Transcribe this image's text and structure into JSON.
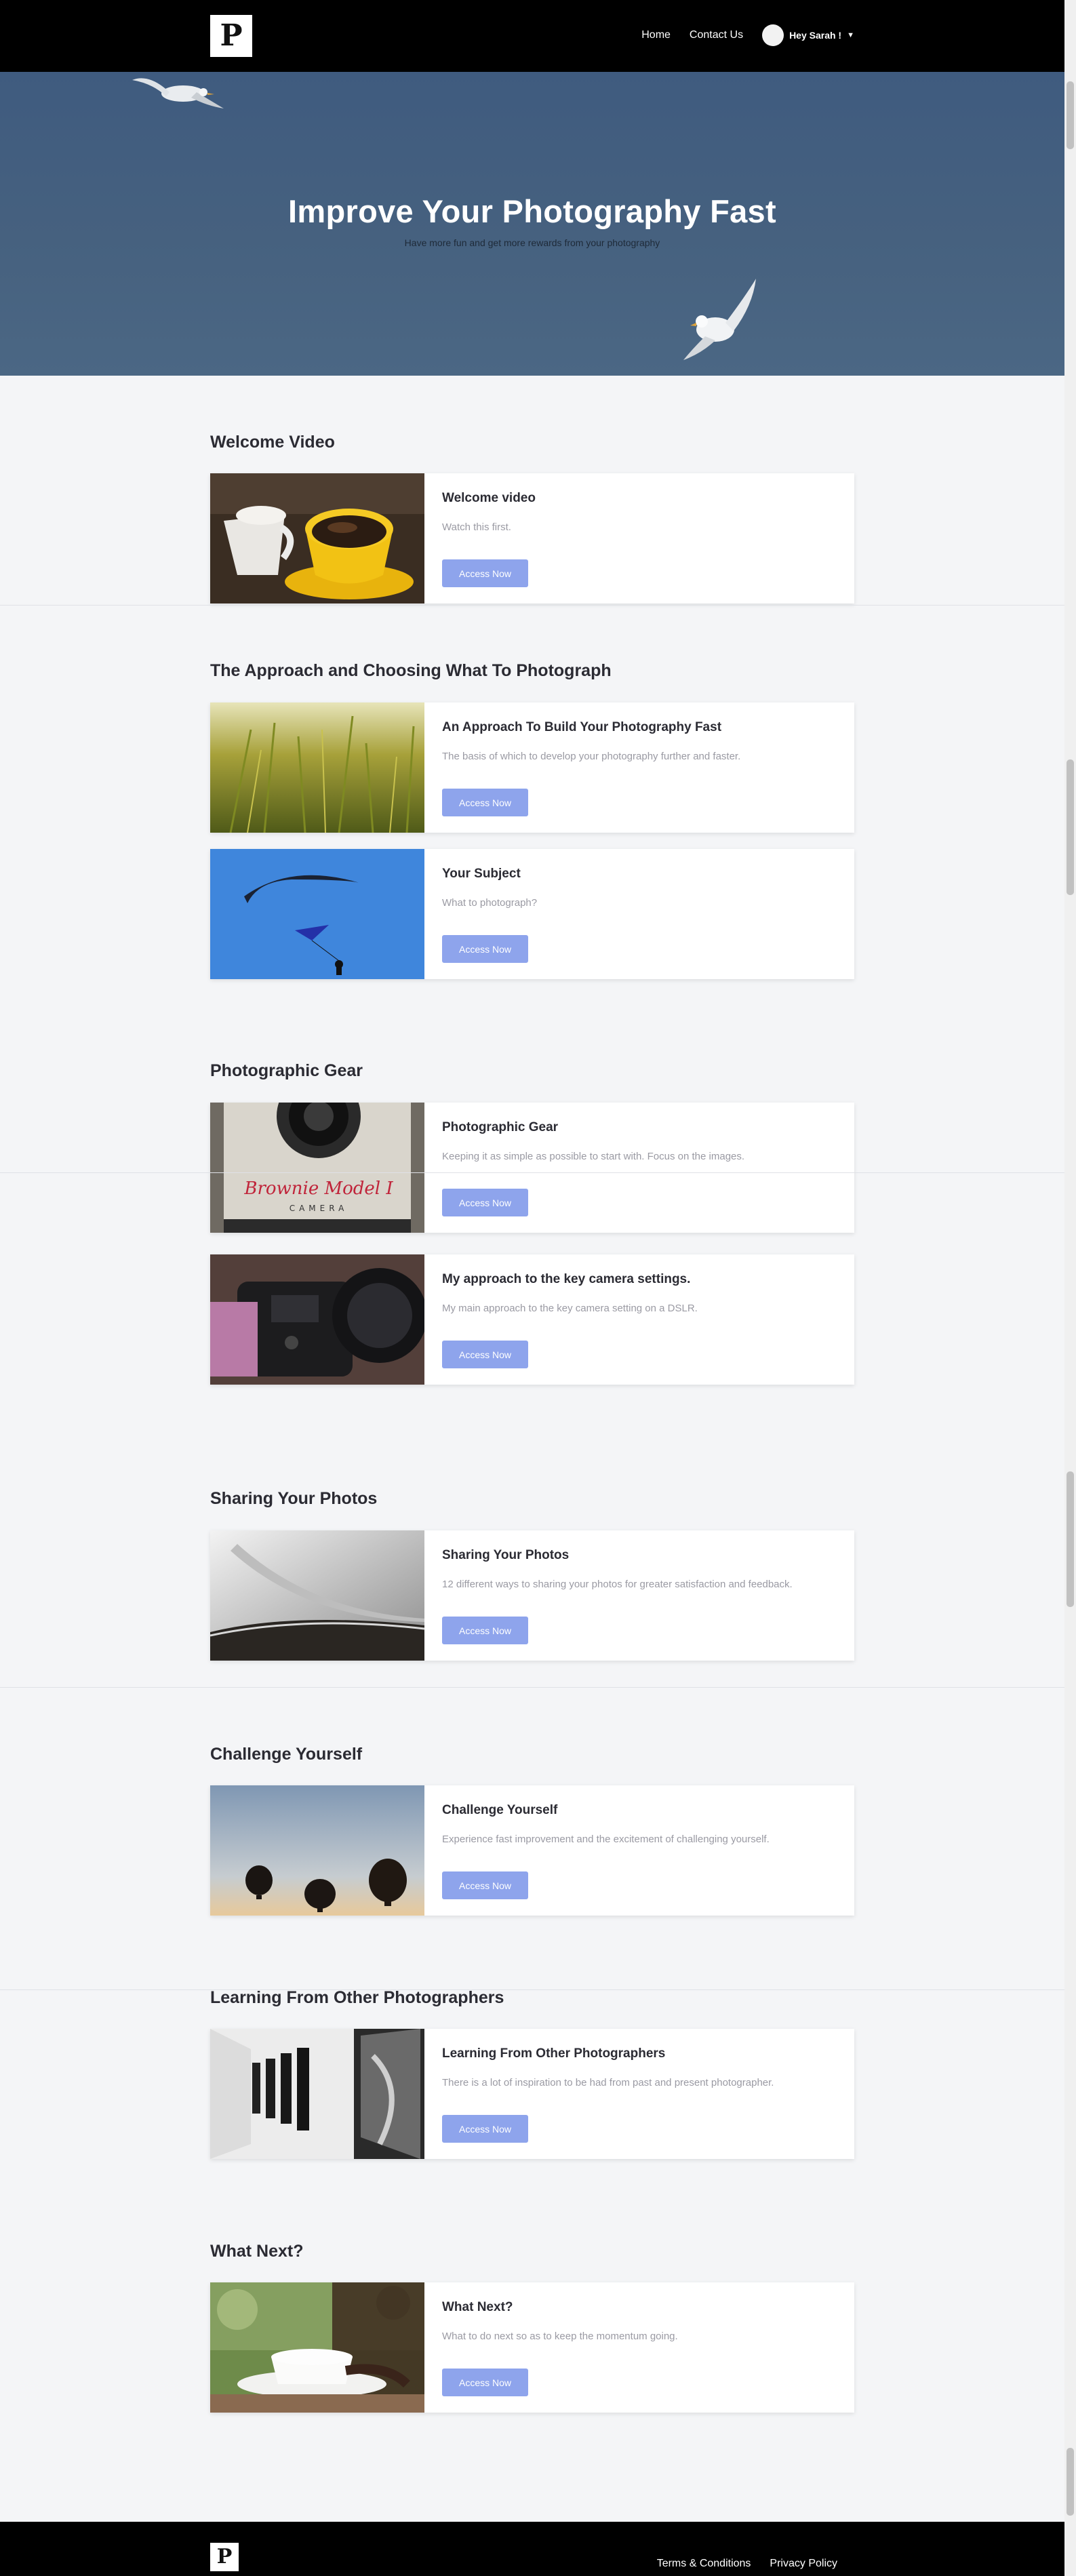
{
  "header": {
    "logo_letter": "P",
    "nav": {
      "home": "Home",
      "contact": "Contact Us"
    },
    "user_greeting": "Hey Sarah !",
    "dropdown_icon": "chevron-down-icon"
  },
  "hero": {
    "title": "Improve Your Photography Fast",
    "subtitle": "Have more fun and get more rewards from your photography"
  },
  "sections": [
    {
      "title": "Welcome Video"
    },
    {
      "title": "The Approach and Choosing What To Photograph"
    },
    {
      "title": "Photographic Gear"
    },
    {
      "title": "Sharing Your Photos"
    },
    {
      "title": "Challenge Yourself"
    },
    {
      "title": "Learning From Other Photographers"
    },
    {
      "title": "What Next?"
    }
  ],
  "cards": [
    {
      "title": "Welcome video",
      "description": "Watch this first.",
      "button": "Access Now"
    },
    {
      "title": "An Approach To Build Your Photography Fast",
      "description": "The basis of which to develop your photography further and faster.",
      "button": "Access Now"
    },
    {
      "title": "Your Subject",
      "description": "What to photograph?",
      "button": "Access Now"
    },
    {
      "title": "Photographic Gear",
      "description": "Keeping it as simple as possible to start with. Focus on the images.",
      "button": "Access Now"
    },
    {
      "title": "My approach to the key camera settings.",
      "description": "My main approach to the key camera setting on a DSLR.",
      "button": "Access Now"
    },
    {
      "title": "Sharing Your Photos",
      "description": "12 different ways to sharing your photos for greater satisfaction and feedback.",
      "button": "Access Now"
    },
    {
      "title": "Challenge Yourself",
      "description": "Experience fast improvement and the excitement of challenging yourself.",
      "button": "Access Now"
    },
    {
      "title": "Learning From Other Photographers",
      "description": "There is a lot of inspiration to be had from past and present photographer.",
      "button": "Access Now"
    },
    {
      "title": "What Next?",
      "description": "What to do next so as to keep the momentum going.",
      "button": "Access Now"
    }
  ],
  "thumbnails": {
    "camera_label_line1": "Brownie Model I",
    "camera_label_line2": "CAMERA"
  },
  "footer": {
    "logo_letter": "P",
    "links": {
      "terms": "Terms & Conditions",
      "privacy": "Privacy Policy"
    }
  },
  "colors": {
    "accent_button": "#8ea4ec",
    "header_bg": "#000000",
    "hero_bg": "#46617f"
  }
}
